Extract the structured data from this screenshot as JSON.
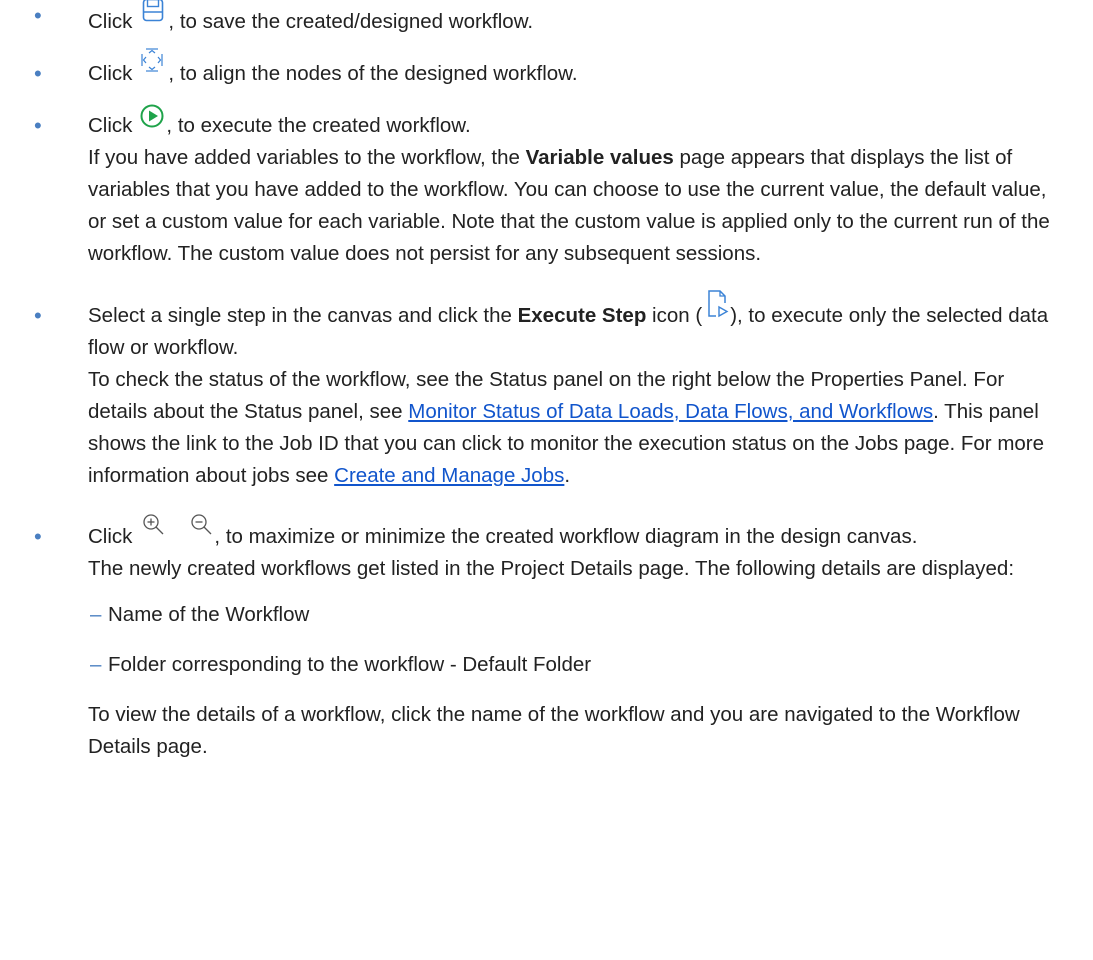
{
  "items": [
    {
      "pre": "Click",
      "post": ", to save the created/designed workflow.",
      "icon": "save-icon"
    },
    {
      "pre": "Click",
      "post": ", to align the nodes of the designed workflow.",
      "icon": "align-nodes-icon"
    },
    {
      "pre": "Click",
      "post": ", to execute the created workflow.",
      "icon": "execute-icon",
      "desc_pre": "If you have added variables to the workflow, the ",
      "desc_bold": "Variable values",
      "desc_post": " page appears that displays the list of variables that you have added to the workflow. You can choose to use the current value, the default value, or set a custom value for each variable. Note that the custom value is applied only to the current run of the workflow. The custom value does not persist for any subsequent sessions."
    },
    {
      "pre": "Select a single step in the canvas and click the ",
      "bold": "Execute Step",
      "mid": " icon (",
      "post": "), to execute only the selected data flow or workflow.",
      "icon": "execute-step-icon",
      "desc_pre": "To check the status of the workflow, see the Status panel on the right below the Properties Panel. For details about the Status panel, see ",
      "link1": "Monitor Status of Data Loads, Data Flows, and Workflows",
      "desc_mid": ". This panel shows the link to the Job ID that you can click to monitor the execution status on the Jobs page. For more information about jobs see ",
      "link2": "Create and Manage Jobs",
      "desc_post": "."
    },
    {
      "pre": "Click",
      "post": ", to maximize or minimize the created workflow diagram in the design canvas.",
      "icons": [
        "zoom-in-icon",
        "zoom-out-icon"
      ],
      "desc": "The newly created workflows get listed in the Project Details page. The following details are displayed:",
      "subitems": [
        "Name of the Workflow",
        "Folder corresponding to the workflow - Default Folder"
      ],
      "closing": "To view the details of a workflow, click the name of the workflow and you are navigated to the Workflow Details page."
    }
  ],
  "colors": {
    "bullet": "#4a7fc1",
    "link": "#1155cc",
    "icon": "#3b83d6",
    "execute_icon": "#1fa34a"
  }
}
